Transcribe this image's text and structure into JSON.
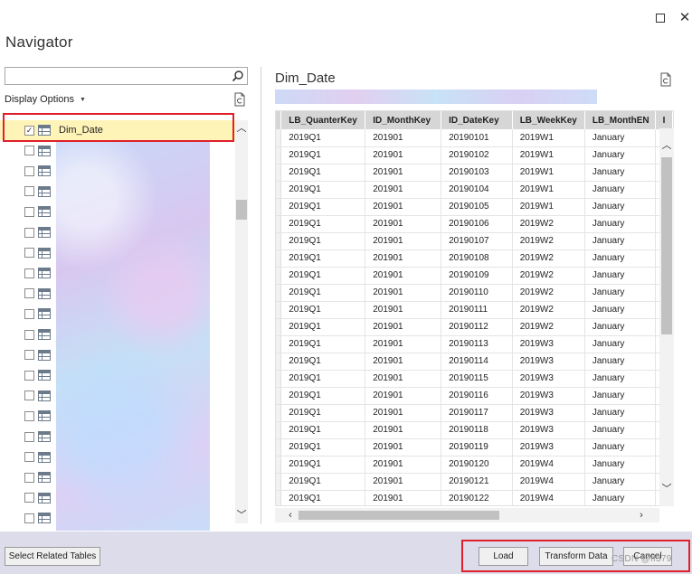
{
  "window": {
    "title": "Navigator",
    "maximize_icon": "maximize-icon",
    "close_icon": "close-icon",
    "close_glyph": "✕"
  },
  "left_pane": {
    "search": {
      "value": "",
      "placeholder": ""
    },
    "display_options_label": "Display Options",
    "items": [
      {
        "label": "Dim_Date",
        "checked": true,
        "selected": true
      },
      {
        "label": "",
        "checked": false
      },
      {
        "label": "",
        "checked": false
      },
      {
        "label": "",
        "checked": false
      },
      {
        "label": "",
        "checked": false
      },
      {
        "label": "",
        "checked": false
      },
      {
        "label": "",
        "checked": false
      },
      {
        "label": "",
        "checked": false
      },
      {
        "label": "",
        "checked": false
      },
      {
        "label": "",
        "checked": false
      },
      {
        "label": "",
        "checked": false
      },
      {
        "label": "",
        "checked": false
      },
      {
        "label": "",
        "checked": false
      },
      {
        "label": "",
        "checked": false
      },
      {
        "label": "",
        "checked": false
      },
      {
        "label": "",
        "checked": false
      },
      {
        "label": "",
        "checked": false
      },
      {
        "label": "",
        "checked": false
      },
      {
        "label": "",
        "checked": false
      },
      {
        "label": "",
        "checked": false
      }
    ]
  },
  "preview": {
    "title": "Dim_Date",
    "columns": [
      "LB_QuanterKey",
      "ID_MonthKey",
      "ID_DateKey",
      "LB_WeekKey",
      "LB_MonthEN",
      "I"
    ],
    "rows": [
      [
        "2019Q1",
        "201901",
        "20190101",
        "2019W1",
        "January"
      ],
      [
        "2019Q1",
        "201901",
        "20190102",
        "2019W1",
        "January"
      ],
      [
        "2019Q1",
        "201901",
        "20190103",
        "2019W1",
        "January"
      ],
      [
        "2019Q1",
        "201901",
        "20190104",
        "2019W1",
        "January"
      ],
      [
        "2019Q1",
        "201901",
        "20190105",
        "2019W1",
        "January"
      ],
      [
        "2019Q1",
        "201901",
        "20190106",
        "2019W2",
        "January"
      ],
      [
        "2019Q1",
        "201901",
        "20190107",
        "2019W2",
        "January"
      ],
      [
        "2019Q1",
        "201901",
        "20190108",
        "2019W2",
        "January"
      ],
      [
        "2019Q1",
        "201901",
        "20190109",
        "2019W2",
        "January"
      ],
      [
        "2019Q1",
        "201901",
        "20190110",
        "2019W2",
        "January"
      ],
      [
        "2019Q1",
        "201901",
        "20190111",
        "2019W2",
        "January"
      ],
      [
        "2019Q1",
        "201901",
        "20190112",
        "2019W2",
        "January"
      ],
      [
        "2019Q1",
        "201901",
        "20190113",
        "2019W3",
        "January"
      ],
      [
        "2019Q1",
        "201901",
        "20190114",
        "2019W3",
        "January"
      ],
      [
        "2019Q1",
        "201901",
        "20190115",
        "2019W3",
        "January"
      ],
      [
        "2019Q1",
        "201901",
        "20190116",
        "2019W3",
        "January"
      ],
      [
        "2019Q1",
        "201901",
        "20190117",
        "2019W3",
        "January"
      ],
      [
        "2019Q1",
        "201901",
        "20190118",
        "2019W3",
        "January"
      ],
      [
        "2019Q1",
        "201901",
        "20190119",
        "2019W3",
        "January"
      ],
      [
        "2019Q1",
        "201901",
        "20190120",
        "2019W4",
        "January"
      ],
      [
        "2019Q1",
        "201901",
        "20190121",
        "2019W4",
        "January"
      ],
      [
        "2019Q1",
        "201901",
        "20190122",
        "2019W4",
        "January"
      ]
    ]
  },
  "footer": {
    "select_related_label": "Select Related Tables",
    "load_label": "Load",
    "transform_label": "Transform Data",
    "cancel_label": "Cancel",
    "watermark": "CSDN @ff379"
  },
  "colors": {
    "highlight_border": "#e0202a",
    "selected_row": "#fff4b8",
    "footer_bg": "#dcdcea"
  },
  "icons": [
    "search-icon",
    "refresh-icon",
    "table-icon",
    "checkbox-icon",
    "chevron-up-icon",
    "chevron-down-icon",
    "chevron-left-icon",
    "chevron-right-icon"
  ]
}
